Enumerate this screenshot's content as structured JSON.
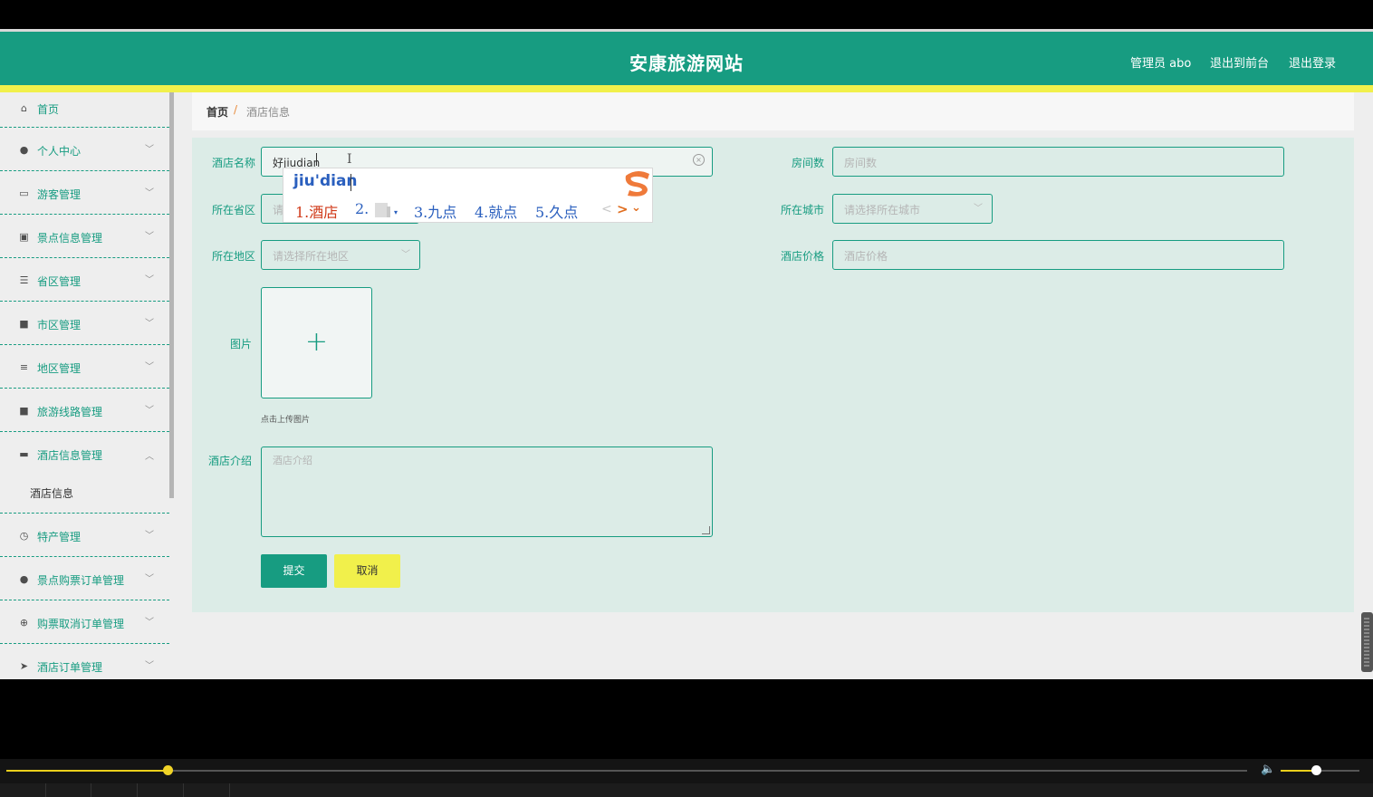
{
  "header": {
    "site_title": "安康旅游网站",
    "admin_label": "管理员 abo",
    "front_link": "退出到前台",
    "logout_link": "退出登录"
  },
  "sidebar": {
    "items": [
      {
        "label": "首页",
        "icon": "home-icon"
      },
      {
        "label": "个人中心",
        "icon": "user-icon"
      },
      {
        "label": "游客管理",
        "icon": "id-card-icon"
      },
      {
        "label": "景点信息管理",
        "icon": "clipboard-icon"
      },
      {
        "label": "省区管理",
        "icon": "list-icon"
      },
      {
        "label": "市区管理",
        "icon": "printer-icon"
      },
      {
        "label": "地区管理",
        "icon": "sliders-icon"
      },
      {
        "label": "旅游线路管理",
        "icon": "video-icon"
      },
      {
        "label": "酒店信息管理",
        "icon": "chat-icon"
      },
      {
        "label": "特产管理",
        "icon": "clock-icon"
      },
      {
        "label": "景点购票订单管理",
        "icon": "user-icon"
      },
      {
        "label": "购票取消订单管理",
        "icon": "crosshair-icon"
      },
      {
        "label": "酒店订单管理",
        "icon": "send-icon"
      }
    ],
    "subitem": "酒店信息"
  },
  "breadcrumb": {
    "home": "首页",
    "separator": "/",
    "current": "酒店信息"
  },
  "form": {
    "hotel_name_label": "酒店名称",
    "hotel_name_value": "好jiudian",
    "room_count_label": "房间数",
    "room_count_placeholder": "房间数",
    "province_label": "所在省区",
    "province_placeholder": "请",
    "city_label": "所在城市",
    "city_placeholder": "请选择所在城市",
    "area_label": "所在地区",
    "area_placeholder": "请选择所在地区",
    "price_label": "酒店价格",
    "price_placeholder": "酒店价格",
    "image_label": "图片",
    "upload_hint": "点击上传图片",
    "intro_label": "酒店介绍",
    "intro_placeholder": "酒店介绍",
    "submit_label": "提交",
    "cancel_label": "取消"
  },
  "ime": {
    "pinyin": "jiu'dian",
    "candidates": [
      "1.酒店",
      "2.",
      "3.九点",
      "4.就点",
      "5.久点"
    ],
    "prev_arrow": "<",
    "next_arrow": ">",
    "expand_arrow": "⌄"
  },
  "player": {
    "progress": 0.13,
    "volume": 0.45
  },
  "colors": {
    "primary": "#179c81",
    "accent": "#f1f04b",
    "panel": "#dcece7"
  }
}
